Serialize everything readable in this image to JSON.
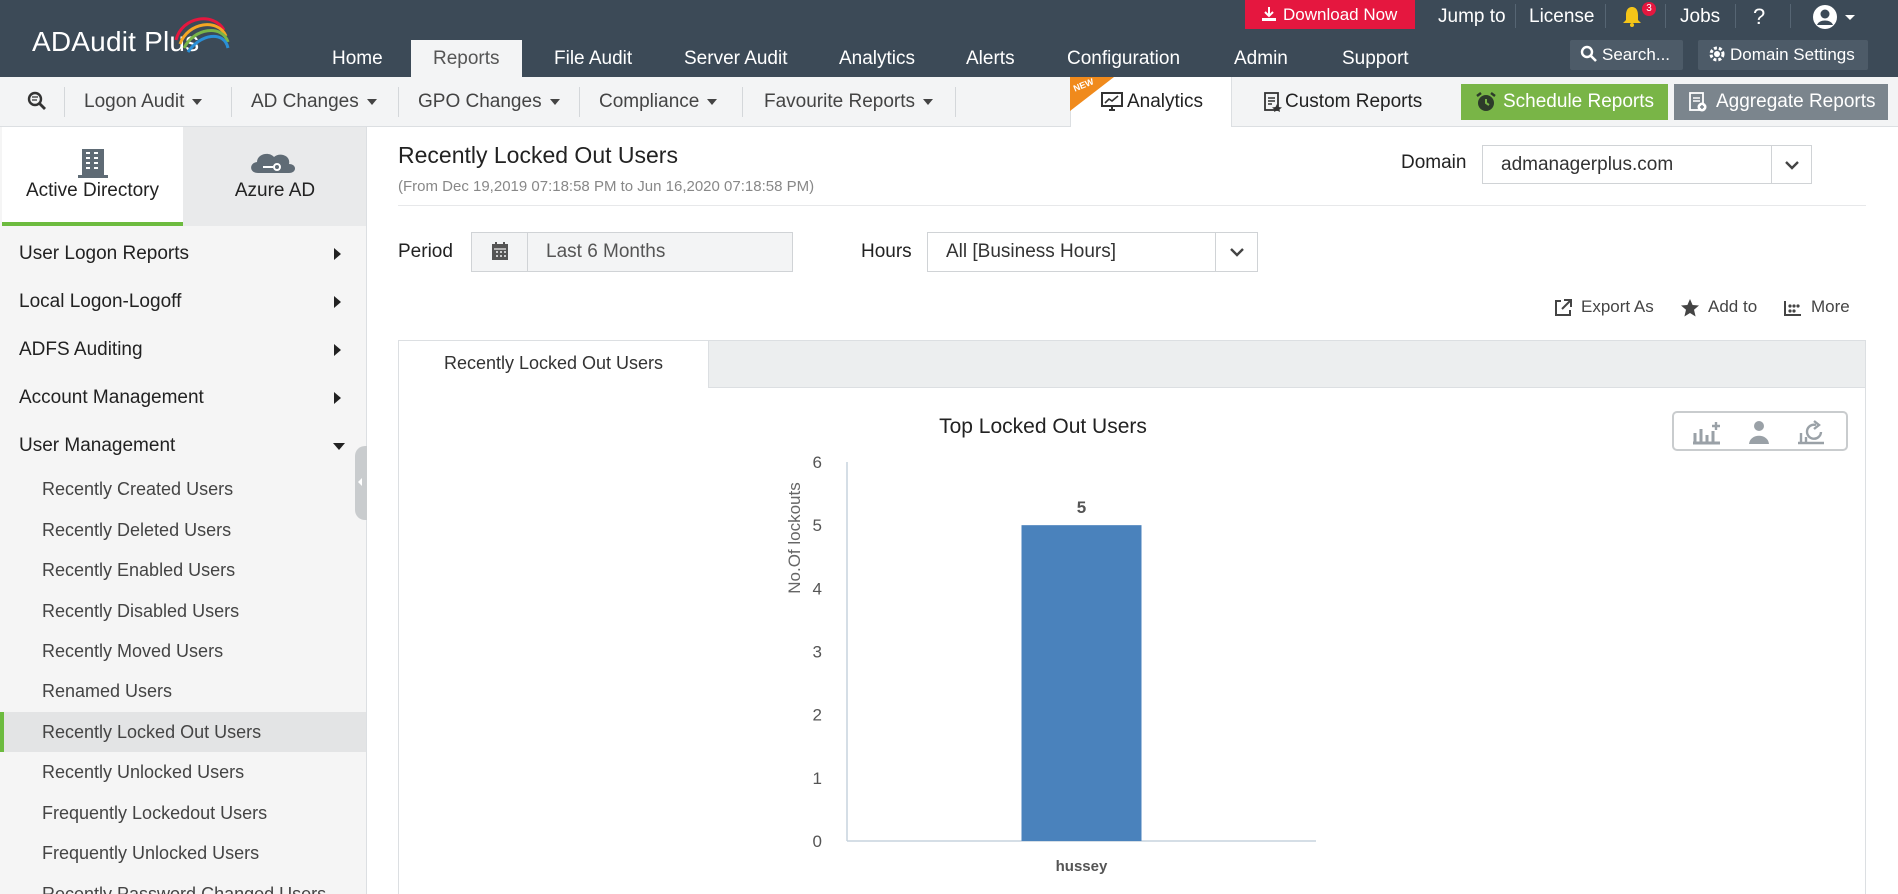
{
  "app": {
    "name": "ADAudit Plus",
    "top_nav": [
      "Home",
      "Reports",
      "File Audit",
      "Server Audit",
      "Analytics",
      "Alerts",
      "Configuration",
      "Admin",
      "Support"
    ],
    "active_top_nav": "Reports",
    "download_label": "Download Now",
    "jump_label": "Jump to",
    "license_label": "License",
    "notification_count": "3",
    "jobs_label": "Jobs",
    "help_label": "?",
    "search_label": "Search...",
    "domain_settings_label": "Domain Settings"
  },
  "subnav": {
    "menus": [
      "Logon Audit",
      "AD Changes",
      "GPO Changes",
      "Compliance",
      "Favourite Reports"
    ],
    "new_badge": "NEW",
    "analytics_label": "Analytics",
    "custom_reports_label": "Custom Reports",
    "schedule_label": "Schedule Reports",
    "aggregate_label": "Aggregate Reports"
  },
  "sidebar": {
    "tabs": [
      {
        "label": "Active Directory",
        "active": true
      },
      {
        "label": "Azure AD",
        "active": false
      }
    ],
    "sections": [
      {
        "label": "User Logon Reports",
        "expanded": false
      },
      {
        "label": "Local Logon-Logoff",
        "expanded": false
      },
      {
        "label": "ADFS Auditing",
        "expanded": false
      },
      {
        "label": "Account Management",
        "expanded": false
      },
      {
        "label": "User Management",
        "expanded": true
      }
    ],
    "items": [
      "Recently Created Users",
      "Recently Deleted Users",
      "Recently Enabled Users",
      "Recently Disabled Users",
      "Recently Moved Users",
      "Renamed Users",
      "Recently Locked Out Users",
      "Recently Unlocked Users",
      "Frequently Lockedout Users",
      "Frequently Unlocked Users",
      "Recently Password Changed Users"
    ],
    "active_item": "Recently Locked Out Users"
  },
  "main": {
    "title": "Recently Locked Out Users",
    "subtitle": "(From Dec 19,2019 07:18:58 PM to Jun 16,2020 07:18:58 PM)",
    "domain_label": "Domain",
    "domain_value": "admanagerplus.com",
    "period_label": "Period",
    "period_value": "Last 6 Months",
    "hours_label": "Hours",
    "hours_value": "All [Business Hours]",
    "actions": [
      "Export As",
      "Add to",
      "More"
    ],
    "report_tab": "Recently Locked Out Users"
  },
  "colors": {
    "topbar": "#3c4a57",
    "download": "#e5173f",
    "schedule": "#79b547",
    "aggregate": "#7b858d",
    "accent_green": "#6dbb3f",
    "bar": "#4a82bc"
  },
  "chart_data": {
    "type": "bar",
    "title": "Top Locked Out Users",
    "xlabel": "",
    "ylabel": "No.Of lockouts",
    "categories": [
      "hussey"
    ],
    "values": [
      5
    ],
    "data_labels": [
      "5"
    ],
    "ylim": [
      0,
      6
    ],
    "yticks": [
      "0",
      "1",
      "2",
      "3",
      "4",
      "5",
      "6"
    ],
    "grid": false,
    "legend": "none"
  }
}
